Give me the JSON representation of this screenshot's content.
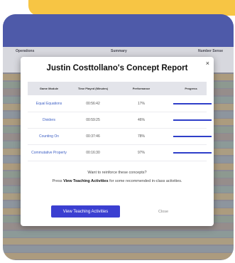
{
  "dashboard": {
    "header_col1": "Operations",
    "header_col2": "Summary",
    "header_col3": "Number Sense"
  },
  "modal": {
    "title": "Justin Costtollano's  Concept Report",
    "columns": [
      "Game Module",
      "Time Played (Minutes)",
      "Performance",
      "Progress"
    ],
    "rows": [
      {
        "module": "Equal Equations",
        "time": "00:56:42",
        "performance": "17%",
        "progress": 1.0
      },
      {
        "module": "Dividers",
        "time": "00:59:25",
        "performance": "46%",
        "progress": 1.0
      },
      {
        "module": "Counting On",
        "time": "00:37:46",
        "performance": "78%",
        "progress": 1.0
      },
      {
        "module": "Commutative Property",
        "time": "00:16:30",
        "performance": "97%",
        "progress": 1.0
      }
    ],
    "prompt_line1": "Want to reinforce these concepts?",
    "prompt_line2_pre": "Press ",
    "prompt_line2_bold": "View Teaching Activities",
    "prompt_line2_post": " for some recommended in-class activities.",
    "primary_button": "View Teaching Activities",
    "close_button": "Close",
    "close_glyph": "×"
  }
}
